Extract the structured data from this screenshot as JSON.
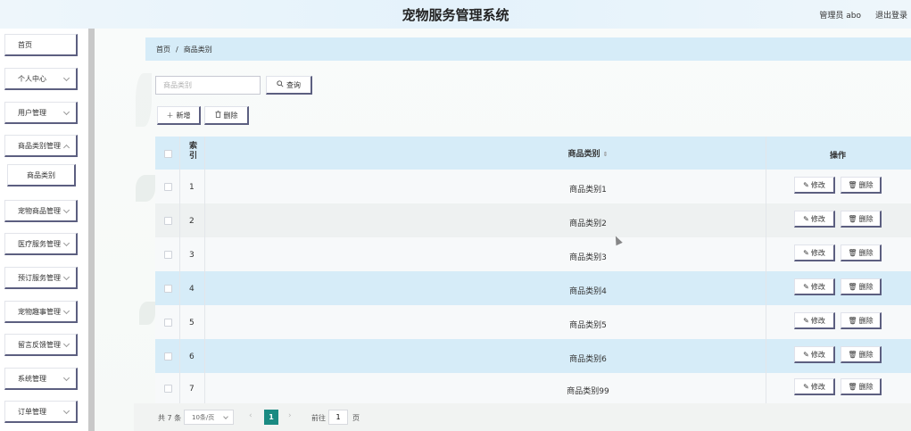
{
  "header": {
    "title": "宠物服务管理系统",
    "user_label": "管理员 abo",
    "logout_label": "退出登录"
  },
  "sidebar": {
    "items": [
      {
        "label": "首页"
      },
      {
        "label": "个人中心"
      },
      {
        "label": "用户管理"
      },
      {
        "label": "商品类别管理"
      },
      {
        "label": "商品类别"
      },
      {
        "label": "宠物商品管理"
      },
      {
        "label": "医疗服务管理"
      },
      {
        "label": "预订服务管理"
      },
      {
        "label": "宠物趣事管理"
      },
      {
        "label": "留言反馈管理"
      },
      {
        "label": "系统管理"
      },
      {
        "label": "订单管理"
      }
    ]
  },
  "breadcrumb": {
    "home": "首页",
    "separator": "/",
    "current": "商品类别"
  },
  "search": {
    "placeholder": "商品类别",
    "button_label": "查询",
    "button_icon": "search-icon"
  },
  "toolbar": {
    "add_label": "新增",
    "delete_label": "删除"
  },
  "table": {
    "columns": {
      "index": "索\n引",
      "name": "商品类别",
      "actions": "操作"
    },
    "edit_label": "修改",
    "delete_label": "删除",
    "rows": [
      {
        "index": "1",
        "name": "商品类别1"
      },
      {
        "index": "2",
        "name": "商品类别2"
      },
      {
        "index": "3",
        "name": "商品类别3"
      },
      {
        "index": "4",
        "name": "商品类别4"
      },
      {
        "index": "5",
        "name": "商品类别5"
      },
      {
        "index": "6",
        "name": "商品类别6"
      },
      {
        "index": "7",
        "name": "商品类别99"
      }
    ]
  },
  "pagination": {
    "total_label": "共 7 条",
    "page_size_label": "10条/页",
    "prev": "‹",
    "current_page": "1",
    "next": "›",
    "goto_label": "前往",
    "goto_value": "1",
    "goto_suffix": "页"
  },
  "colors": {
    "accent": "#d6ecf8",
    "button_shadow": "#5c5f80",
    "pager_active": "#1a8a82"
  }
}
